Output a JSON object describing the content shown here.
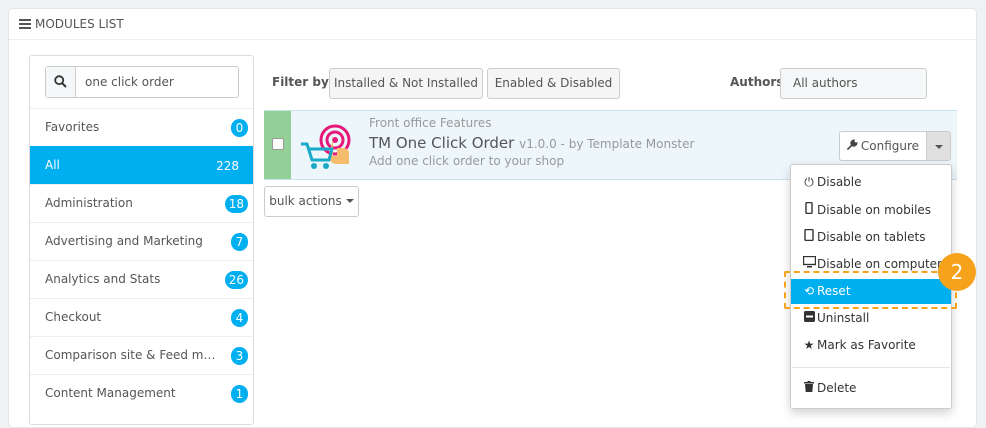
{
  "panel": {
    "title": "MODULES LIST"
  },
  "search": {
    "value": "one click order"
  },
  "categories": [
    {
      "label": "Favorites",
      "count": "0"
    },
    {
      "label": "All",
      "count": "228"
    },
    {
      "label": "Administration",
      "count": "18"
    },
    {
      "label": "Advertising and Marketing",
      "count": "7"
    },
    {
      "label": "Analytics and Stats",
      "count": "26"
    },
    {
      "label": "Checkout",
      "count": "4"
    },
    {
      "label": "Comparison site & Feed man...",
      "count": "3"
    },
    {
      "label": "Content Management",
      "count": "1"
    }
  ],
  "filter": {
    "label": "Filter by",
    "installed_btn": "Installed & Not Installed",
    "enabled_btn": "Enabled & Disabled",
    "authors_label": "Authors",
    "authors_value": "All authors"
  },
  "module": {
    "category": "Front office Features",
    "name": "TM One Click Order",
    "version": "v1.0.0 - by Template Monster",
    "description": "Add one click order to your shop",
    "configure_label": "Configure"
  },
  "bulk": {
    "label": "bulk actions"
  },
  "dropdown": {
    "items": [
      {
        "icon": "power-icon",
        "label": "Disable"
      },
      {
        "icon": "mobile-icon",
        "label": "Disable on mobiles"
      },
      {
        "icon": "tablet-icon",
        "label": "Disable on tablets"
      },
      {
        "icon": "desktop-icon",
        "label": "Disable on computers"
      },
      {
        "icon": "reset-icon",
        "label": "Reset"
      },
      {
        "icon": "minus-square-icon",
        "label": "Uninstall"
      },
      {
        "icon": "star-icon",
        "label": "Mark as Favorite"
      },
      {
        "icon": "trash-icon",
        "label": "Delete"
      }
    ]
  },
  "annotation": {
    "step": "2"
  },
  "colors": {
    "accent": "#00aff0",
    "enabled": "#92d097",
    "callout": "#f7a21b"
  }
}
